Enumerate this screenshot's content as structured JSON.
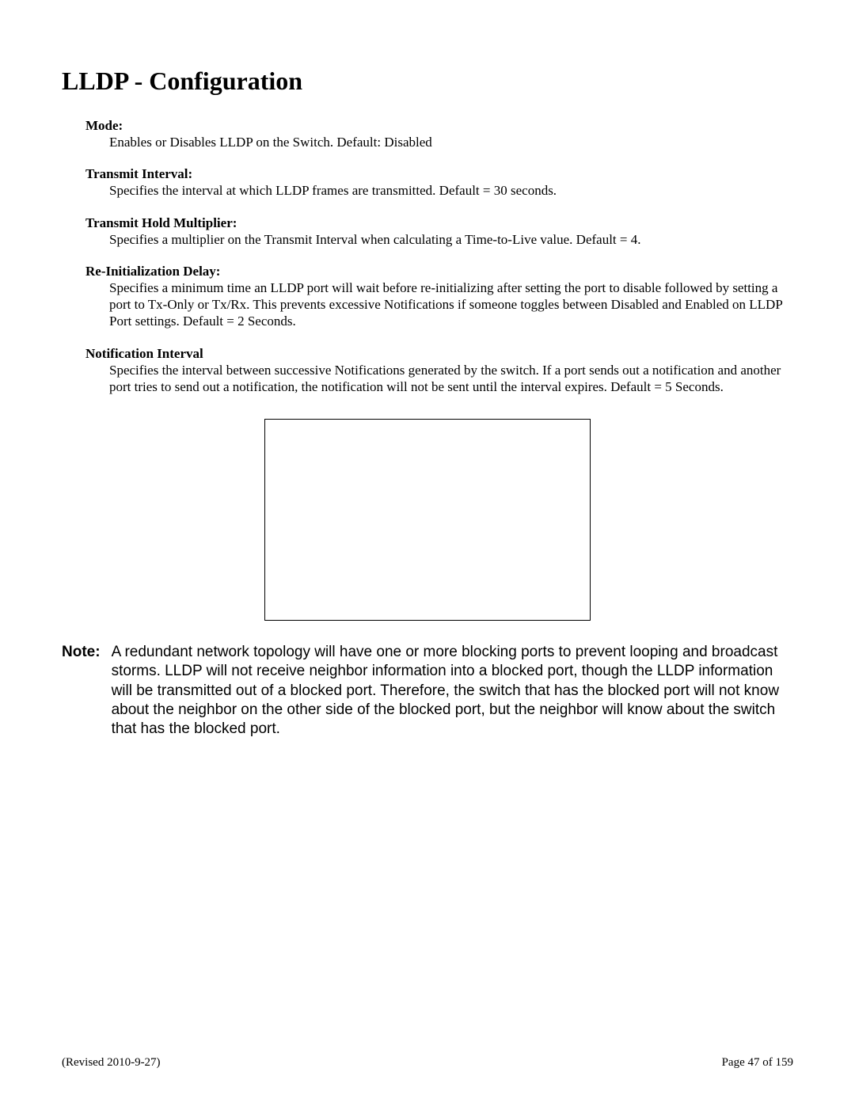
{
  "title": "LLDP - Configuration",
  "sections": [
    {
      "label": "Mode:",
      "body": "Enables or Disables LLDP on the Switch. Default: Disabled"
    },
    {
      "label": "Transmit Interval:",
      "body": "Specifies the interval at which LLDP frames are transmitted.  Default = 30 seconds."
    },
    {
      "label": "Transmit Hold Multiplier:",
      "body": "Specifies a multiplier on the Transmit Interval when calculating a Time-to-Live value. Default = 4."
    },
    {
      "label": "Re-Initialization Delay:",
      "body": "Specifies a minimum time an LLDP port will wait before re-initializing after setting the port to disable followed by  setting a port to Tx-Only or Tx/Rx.  This prevents excessive Notifications if someone toggles between Disabled and Enabled on LLDP Port settings. Default = 2 Seconds."
    },
    {
      "label": "Notification Interval",
      "body": "Specifies the interval between successive Notifications generated by the switch. If a port sends out a notification and another port tries to send out a notification, the notification will not be sent until the interval expires. Default = 5 Seconds."
    }
  ],
  "note": {
    "label": "Note:",
    "body": "A redundant network topology will have one or more blocking ports to prevent looping and broadcast storms. LLDP will not receive neighbor information into a blocked port, though the LLDP information will be transmitted out of a blocked port. Therefore, the switch that has the blocked port will not know about the neighbor on the other side of the blocked port, but the neighbor will know about the switch that has the blocked port."
  },
  "footer": {
    "left": "(Revised 2010-9-27)",
    "right": "Page 47 of 159"
  }
}
